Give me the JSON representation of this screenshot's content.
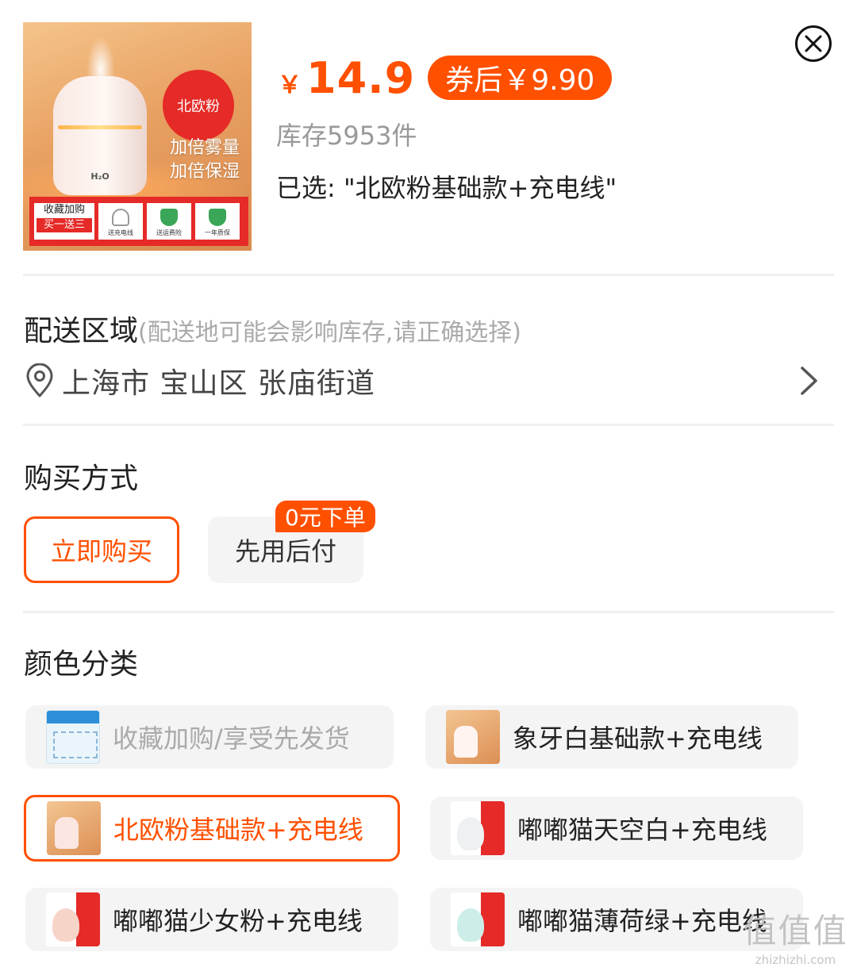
{
  "product": {
    "thumb": {
      "badge": "北欧粉",
      "tagline_1": "加倍雾量",
      "tagline_2": "加倍保湿",
      "device_label": "H₂O",
      "promo_line1": "收藏加购",
      "promo_line2": "买一送三",
      "tiles": [
        "送充电线",
        "送运费险",
        "一年质保"
      ]
    },
    "price_symbol": "￥",
    "price": "14.9",
    "coupon_label": "券后￥9.90",
    "stock": "库存5953件",
    "selected": "已选: \"北欧粉基础款+充电线\""
  },
  "delivery": {
    "title": "配送区域",
    "hint": "(配送地可能会影响库存,请正确选择)",
    "address": "上海市 宝山区 张庙街道"
  },
  "purchase": {
    "title": "购买方式",
    "options": [
      "立即购买",
      "先用后付"
    ],
    "badge": "0元下单",
    "selected_index": 0
  },
  "colors": {
    "title": "颜色分类",
    "options": [
      {
        "label": "收藏加购/享受先发货",
        "state": "disabled"
      },
      {
        "label": "象牙白基础款+充电线",
        "state": "normal"
      },
      {
        "label": "北欧粉基础款+充电线",
        "state": "selected"
      },
      {
        "label": "嘟嘟猫天空白+充电线",
        "state": "normal"
      },
      {
        "label": "嘟嘟猫少女粉+充电线",
        "state": "normal"
      },
      {
        "label": "嘟嘟猫薄荷绿+充电线",
        "state": "normal"
      }
    ]
  },
  "theme": {
    "accent": "#ff5000",
    "muted": "#aaaaaa",
    "chip_bg": "#f4f4f4"
  },
  "icons": [
    "close-icon",
    "location-pin-icon",
    "chevron-right-icon"
  ],
  "watermark": {
    "title": "值值值",
    "url": "zhizhizhi.com"
  }
}
